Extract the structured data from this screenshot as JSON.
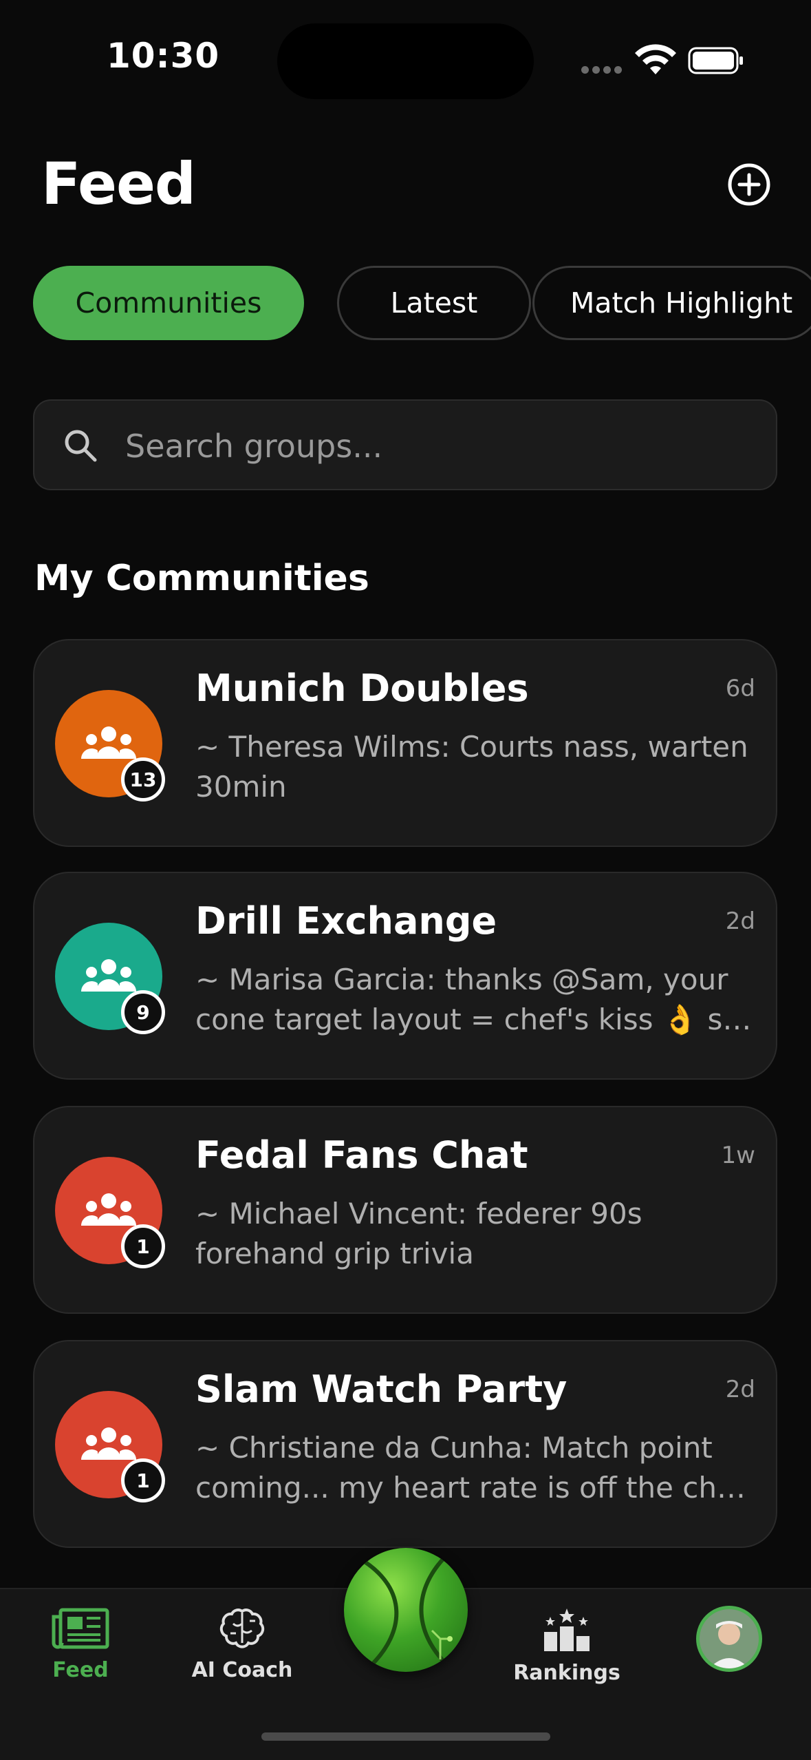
{
  "status_bar": {
    "time": "10:30"
  },
  "header": {
    "title": "Feed"
  },
  "tabs": [
    {
      "label": "Communities",
      "active": true
    },
    {
      "label": "Latest",
      "active": false
    },
    {
      "label": "Match Highlight",
      "active": false
    }
  ],
  "search": {
    "placeholder": "Search groups..."
  },
  "section": {
    "title": "My Communities"
  },
  "communities": [
    {
      "name": "Munich Doubles",
      "time": "6d",
      "badge": "13",
      "color": "#e0650f",
      "preview_line1": "~ Theresa Wilms: Courts nass, warten",
      "preview_line2": "30min"
    },
    {
      "name": "Drill Exchange",
      "time": "2d",
      "badge": "9",
      "color": "#1aaa8c",
      "preview_line1": "~ Marisa Garcia: thanks @Sam, your",
      "preview_line2": "cone target layout = chef's kiss 👌 sav..."
    },
    {
      "name": "Fedal Fans Chat",
      "time": "1w",
      "badge": "1",
      "color": "#d9432f",
      "preview_line1": "~ Michael Vincent: federer 90s",
      "preview_line2": "forehand grip trivia"
    },
    {
      "name": "Slam Watch Party",
      "time": "2d",
      "badge": "1",
      "color": "#d9432f",
      "preview_line1": "~ Christiane da Cunha: Match point",
      "preview_line2": "coming... my heart rate is off the chart..."
    }
  ],
  "nav": {
    "feed": "Feed",
    "coach": "AI Coach",
    "rankings": "Rankings"
  },
  "colors": {
    "accent": "#4caf50",
    "background": "#0a0a0a",
    "card": "#1a1a1a"
  }
}
